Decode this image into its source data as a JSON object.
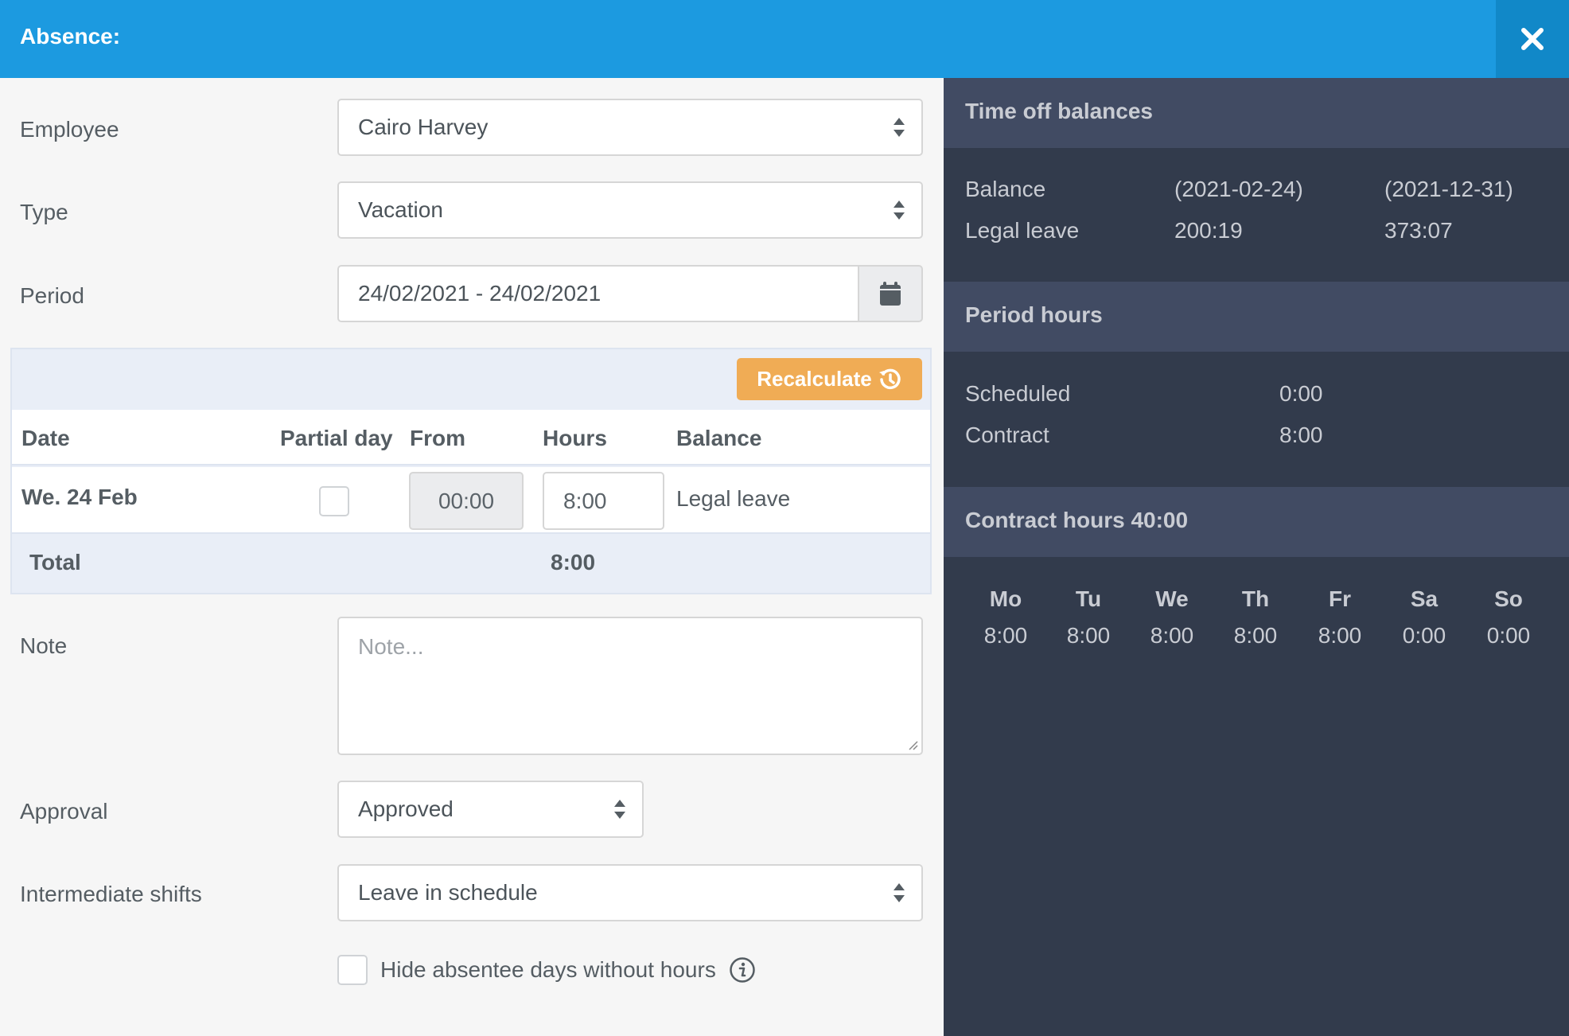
{
  "header": {
    "title": "Absence:",
    "close_icon": "close-x-icon"
  },
  "form": {
    "employee": {
      "label": "Employee",
      "value": "Cairo Harvey"
    },
    "type": {
      "label": "Type",
      "value": "Vacation"
    },
    "period": {
      "label": "Period",
      "value": "24/02/2021 - 24/02/2021",
      "icon": "calendar-icon"
    },
    "note": {
      "label": "Note",
      "placeholder": "Note...",
      "value": ""
    },
    "approval": {
      "label": "Approval",
      "value": "Approved"
    },
    "intermediate_shifts": {
      "label": "Intermediate shifts",
      "value": "Leave in schedule"
    },
    "hide_absentee": {
      "label": "Hide absentee days without hours",
      "checked": false,
      "icon": "info-icon"
    }
  },
  "days_table": {
    "recalculate_label": "Recalculate",
    "recalculate_icon": "history-icon",
    "columns": [
      "Date",
      "Partial day",
      "From",
      "Hours",
      "Balance"
    ],
    "rows": [
      {
        "date": "We. 24 Feb",
        "partial_day": false,
        "from": "00:00",
        "hours": "8:00",
        "balance": "Legal leave"
      }
    ],
    "total_label": "Total",
    "total_hours": "8:00"
  },
  "sidebar": {
    "time_off": {
      "title": "Time off balances",
      "header": [
        "Balance",
        "(2021-02-24)",
        "(2021-12-31)"
      ],
      "rows": [
        {
          "name": "Legal leave",
          "current": "200:19",
          "end": "373:07"
        }
      ]
    },
    "period_hours": {
      "title": "Period hours",
      "rows": [
        {
          "name": "Scheduled",
          "value": "0:00"
        },
        {
          "name": "Contract",
          "value": "8:00"
        }
      ]
    },
    "contract_hours": {
      "title": "Contract hours 40:00",
      "days": [
        {
          "day": "Mo",
          "hours": "8:00"
        },
        {
          "day": "Tu",
          "hours": "8:00"
        },
        {
          "day": "We",
          "hours": "8:00"
        },
        {
          "day": "Th",
          "hours": "8:00"
        },
        {
          "day": "Fr",
          "hours": "8:00"
        },
        {
          "day": "Sa",
          "hours": "0:00"
        },
        {
          "day": "So",
          "hours": "0:00"
        }
      ]
    }
  },
  "colors": {
    "header_bg": "#1c9ae0",
    "close_bg": "#1188c8",
    "recalculate_bg": "#f0ac55",
    "sidebar_bg": "#323b4c",
    "sidebar_section_bg": "#414b63"
  }
}
